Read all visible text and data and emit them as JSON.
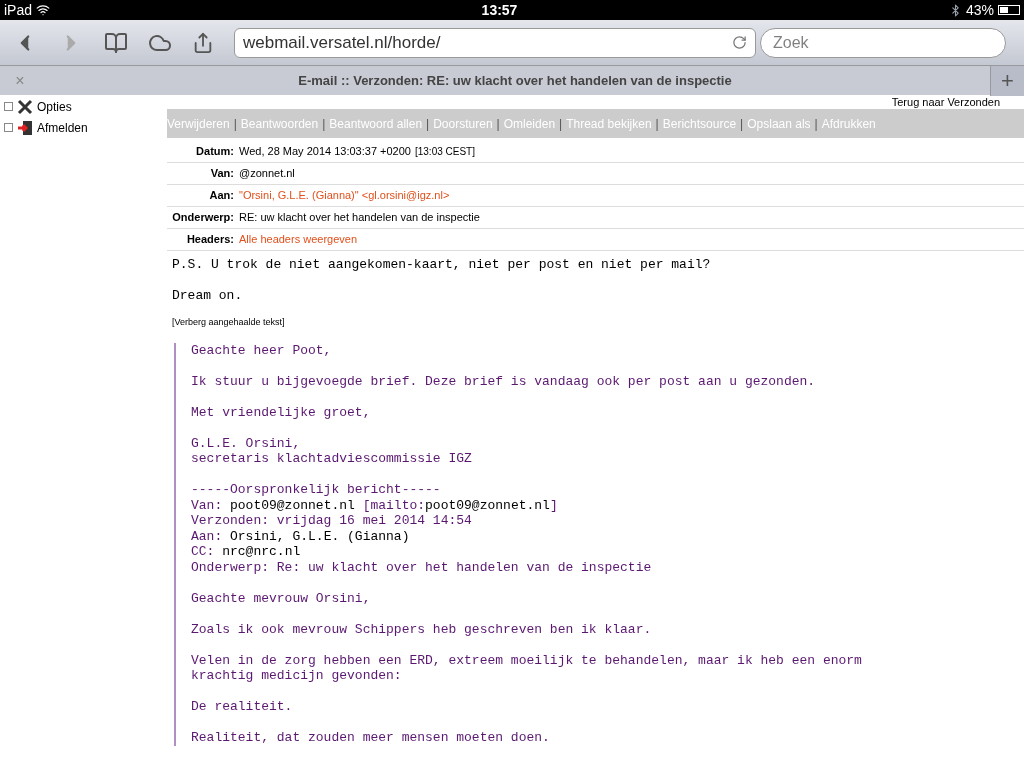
{
  "status_bar": {
    "device": "iPad",
    "time": "13:57",
    "battery": "43%"
  },
  "browser": {
    "url": "webmail.versatel.nl/horde/",
    "search_placeholder": "Zoek",
    "tab_title": "E-mail :: Verzonden: RE: uw klacht over het handelen van de inspectie",
    "tab_close": "×",
    "new_tab": "+"
  },
  "sidebar": {
    "items": [
      {
        "label": "Opties",
        "kind": "tools",
        "checked": false
      },
      {
        "label": "Afmelden",
        "kind": "logout",
        "checked": false
      }
    ]
  },
  "action_separator": "|",
  "back_link": "Terug naar Verzonden",
  "actions": [
    "Verwijderen",
    "Beantwoorden",
    "Beantwoord allen",
    "Doorsturen",
    "Omleiden",
    "Thread bekijken",
    "Berichtsource",
    "Opslaan als",
    "Afdrukken"
  ],
  "headers": [
    {
      "label": "Datum:",
      "value": "Wed, 28 May 2014 13:03:37 +0200",
      "note": "[13:03 CEST]",
      "kind": "text"
    },
    {
      "label": "Van:",
      "value": "@zonnet.nl",
      "kind": "text"
    },
    {
      "label": "Aan:",
      "value": "\"Orsini, G.L.E. (Gianna)\" <gl.orsini@igz.nl>",
      "kind": "link"
    },
    {
      "label": "Onderwerp:",
      "value": "RE: uw klacht over het handelen van de inspectie",
      "kind": "text"
    },
    {
      "label": "Headers:",
      "value": "Alle headers weergeven",
      "kind": "link"
    }
  ],
  "body": [
    [
      "P.S. U trok de niet aangekomen-kaart, niet per post en niet per mail?"
    ],
    [
      "Dream on."
    ]
  ],
  "toggle_quote": "[Verberg aangehaalde tekst]",
  "quote": [
    [
      [
        "Geachte heer Poot,"
      ]
    ],
    [
      [
        "Ik stuur u bijgevoegde brief. Deze brief is vandaag ook per post aan u gezonden."
      ]
    ],
    [
      [
        "Met vriendelijke groet,"
      ]
    ],
    [
      [
        "G.L.E. Orsini,"
      ],
      [
        "secretaris klachtadviescommissie IGZ"
      ]
    ],
    [
      [
        "-----Oorspronkelijk bericht-----"
      ],
      [
        "Van: ",
        {
          "link": "poot09@zonnet.nl"
        },
        " [mailto:",
        {
          "link": "poot09@zonnet.nl"
        },
        "]"
      ],
      [
        "Verzonden: vrijdag 16 mei 2014 14:54"
      ],
      [
        "Aan: ",
        {
          "link": "Orsini, G.L.E. (Gianna)"
        }
      ],
      [
        "CC: ",
        {
          "link": "nrc@nrc.nl"
        }
      ],
      [
        "Onderwerp: Re: uw klacht over het handelen van de inspectie"
      ]
    ],
    [
      [
        "Geachte mevrouw Orsini,"
      ]
    ],
    [
      [
        "Zoals ik ook mevrouw Schippers heb geschreven ben ik klaar."
      ]
    ],
    [
      [
        "Velen in de zorg hebben een ERD, extreem moeilijk te behandelen, maar ik heb een enorm"
      ],
      [
        "krachtig medicijn gevonden:"
      ]
    ],
    [
      [
        "De realiteit."
      ]
    ],
    [
      [
        "Realiteit, dat zouden meer mensen moeten doen."
      ]
    ]
  ]
}
